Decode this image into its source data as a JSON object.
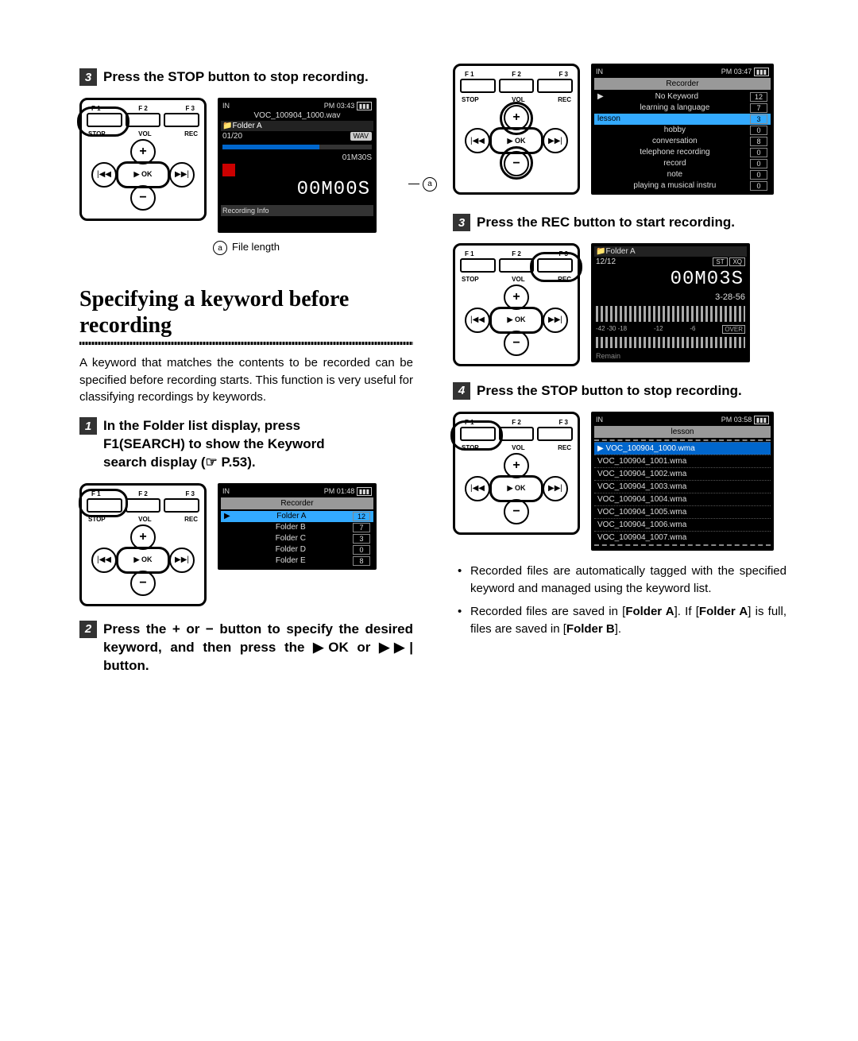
{
  "left": {
    "step3_top": {
      "num": "3",
      "text_prefix": "Press the ",
      "text_bold": "STOP",
      "text_suffix": " button to stop recording."
    },
    "device_labels": {
      "f1": "F 1",
      "f2": "F 2",
      "f3": "F 3",
      "stop": "STOP",
      "vol": "VOL",
      "rec": "REC",
      "ok": "▶ OK"
    },
    "screen1": {
      "in": "IN",
      "clock": "PM 03:43",
      "file": "VOC_100904_1000.wav",
      "folder": "📁Folder A",
      "count": "01/20",
      "format": "WAV",
      "pos": "01M30S",
      "length": "00M00S",
      "recinfo": "Recording Info"
    },
    "callout_a": "a",
    "caption_a": "File length",
    "section_title": "Specifying a keyword before recording",
    "section_body": "A keyword that matches the contents to be recorded can be specified before recording starts. This function is very useful for classifying recordings by keywords.",
    "step1": {
      "num": "1",
      "line1": "In the Folder list display, press",
      "line2": "F1(SEARCH) to show the Keyword",
      "line3": "search display (☞ P.53)."
    },
    "screen2": {
      "in": "IN",
      "clock": "PM 01:48",
      "title": "Recorder",
      "rows": [
        {
          "name": "Folder A",
          "cnt": "12",
          "sel": true
        },
        {
          "name": "Folder B",
          "cnt": "7"
        },
        {
          "name": "Folder C",
          "cnt": "3"
        },
        {
          "name": "Folder D",
          "cnt": "0"
        },
        {
          "name": "Folder E",
          "cnt": "8"
        }
      ]
    },
    "step2": {
      "num": "2",
      "text": "Press the + or − button to specify the desired keyword, and then press the ▶OK or ▶▶| button."
    }
  },
  "right": {
    "screenKW": {
      "in": "IN",
      "clock": "PM 03:47",
      "title": "Recorder",
      "rows": [
        {
          "name": "No Keyword",
          "cnt": "12"
        },
        {
          "name": "learning a language",
          "cnt": "7"
        },
        {
          "name": "lesson",
          "cnt": "3",
          "sel": true
        },
        {
          "name": "hobby",
          "cnt": "0"
        },
        {
          "name": "conversation",
          "cnt": "8"
        },
        {
          "name": "telephone recording",
          "cnt": "0"
        },
        {
          "name": "record",
          "cnt": "0"
        },
        {
          "name": "note",
          "cnt": "0"
        },
        {
          "name": "playing a musical instru",
          "cnt": "0"
        }
      ]
    },
    "step3": {
      "num": "3",
      "text_prefix": "Press the ",
      "text_bold": "REC",
      "text_suffix": " button to start recording."
    },
    "screenRec": {
      "folder": "📁Folder A",
      "count": "12/12",
      "mode": "ST",
      "xq": "XQ",
      "time": "00M03S",
      "remain": "3-28-56",
      "scale_left": "-42 -30 -18",
      "scale_mid": "-12",
      "scale_right": "-6",
      "over": "OVER",
      "bottom": "Remain"
    },
    "step4": {
      "num": "4",
      "text_prefix": "Press the ",
      "text_bold": "STOP",
      "text_suffix": " button to stop recording."
    },
    "screenList": {
      "in": "IN",
      "clock": "PM 03:58",
      "title": "lesson",
      "rows": [
        {
          "name": "VOC_100904_1000.wma",
          "sel": true
        },
        {
          "name": "VOC_100904_1001.wma"
        },
        {
          "name": "VOC_100904_1002.wma"
        },
        {
          "name": "VOC_100904_1003.wma"
        },
        {
          "name": "VOC_100904_1004.wma"
        },
        {
          "name": "VOC_100904_1005.wma"
        },
        {
          "name": "VOC_100904_1006.wma"
        },
        {
          "name": "VOC_100904_1007.wma"
        }
      ]
    },
    "bullet1": "Recorded files are automatically tagged with the specified keyword and managed using the keyword list.",
    "bullet2_pre": "Recorded files are saved in [",
    "bullet2_b1": "Folder A",
    "bullet2_mid": "]. If [",
    "bullet2_b2": "Folder A",
    "bullet2_mid2": "] is full, files are saved in [",
    "bullet2_b3": "Folder B",
    "bullet2_end": "]."
  }
}
